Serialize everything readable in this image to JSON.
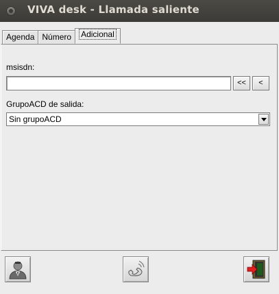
{
  "window": {
    "title": "VIVA desk - Llamada saliente"
  },
  "tabs": [
    {
      "label": "Agenda",
      "active": false
    },
    {
      "label": "Número",
      "active": false
    },
    {
      "label": "Adicional",
      "active": true
    }
  ],
  "form": {
    "msisdn_label": "msisdn:",
    "msisdn_value": "",
    "btn_first": "<<",
    "btn_prev": "<",
    "group_label": "GrupoACD de salida:",
    "group_selected": "Sin grupoACD"
  },
  "footer": {
    "left_icon": "agent-icon",
    "center_icon": "phone-call-icon",
    "right_icon": "exit-door-icon"
  }
}
